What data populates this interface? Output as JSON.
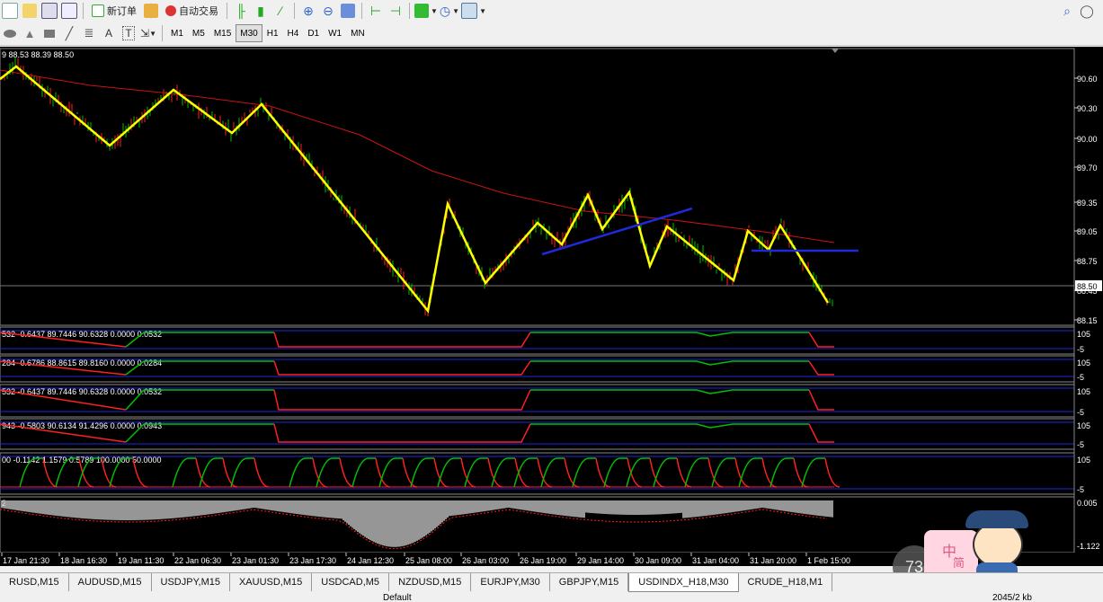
{
  "toolbar": {
    "new_order_label": "新订单",
    "auto_trade_label": "自动交易",
    "timeframes": [
      "M1",
      "M5",
      "M15",
      "M30",
      "H1",
      "H4",
      "D1",
      "W1",
      "MN"
    ],
    "active_timeframe": "M30"
  },
  "chart": {
    "ohlc_header": "9 88.53 88.39 88.50",
    "current_price": "88.50",
    "price_ticks": [
      "90.60",
      "90.30",
      "90.00",
      "89.70",
      "89.35",
      "89.05",
      "88.75",
      "88.45",
      "88.15"
    ],
    "time_labels": [
      "17 Jan 21:30",
      "18 Jan 16:30",
      "19 Jan 11:30",
      "22 Jan 06:30",
      "23 Jan 01:30",
      "23 Jan 17:30",
      "24 Jan 12:30",
      "25 Jan 08:00",
      "26 Jan 03:00",
      "26 Jan 19:00",
      "29 Jan 14:00",
      "30 Jan 09:00",
      "31 Jan 04:00",
      "31 Jan 20:00",
      "1 Feb 15:00"
    ],
    "indicators": [
      {
        "header": "532 -0.6437 89.7446 90.6328 0.0000 0.0532",
        "top": "105",
        "bottom": "-5"
      },
      {
        "header": "284 -0.6786 88.8615 89.8160 0.0000 0.0284",
        "top": "105",
        "bottom": "-5"
      },
      {
        "header": "532 -0.6437 89.7446 90.6328 0.0000 0.0532",
        "top": "105",
        "bottom": "-5"
      },
      {
        "header": "943 -0.5803 90.6134 91.4296 0.0000 0.0943",
        "top": "105",
        "bottom": "-5"
      },
      {
        "header": "00 -0.1142 1.1579 0.5789 100.0000 50.0000",
        "top": "105",
        "bottom": "-5"
      }
    ],
    "osc": {
      "header": "2",
      "top": "0.005",
      "bottom": "-1.122"
    },
    "colors": {
      "bull": "#00c000",
      "bear": "#ff2020",
      "zigzag": "#ffff00",
      "trend": "#1e2adc",
      "ma": "#c81414",
      "grid": "#3a3a3a"
    }
  },
  "badge": {
    "value": "73"
  },
  "mascot_text": {
    "a": "中",
    "b": "简"
  },
  "symbol_tabs": [
    "RUSD,M15",
    "AUDUSD,M15",
    "USDJPY,M15",
    "XAUUSD,M15",
    "USDCAD,M5",
    "NZDUSD,M15",
    "EURJPY,M30",
    "GBPJPY,M15",
    "USDINDX_H18,M30",
    "CRUDE_H18,M1"
  ],
  "active_symbol_tab": "USDINDX_H18,M30",
  "status": {
    "profile": "Default",
    "traffic": "2045/2 kb"
  }
}
